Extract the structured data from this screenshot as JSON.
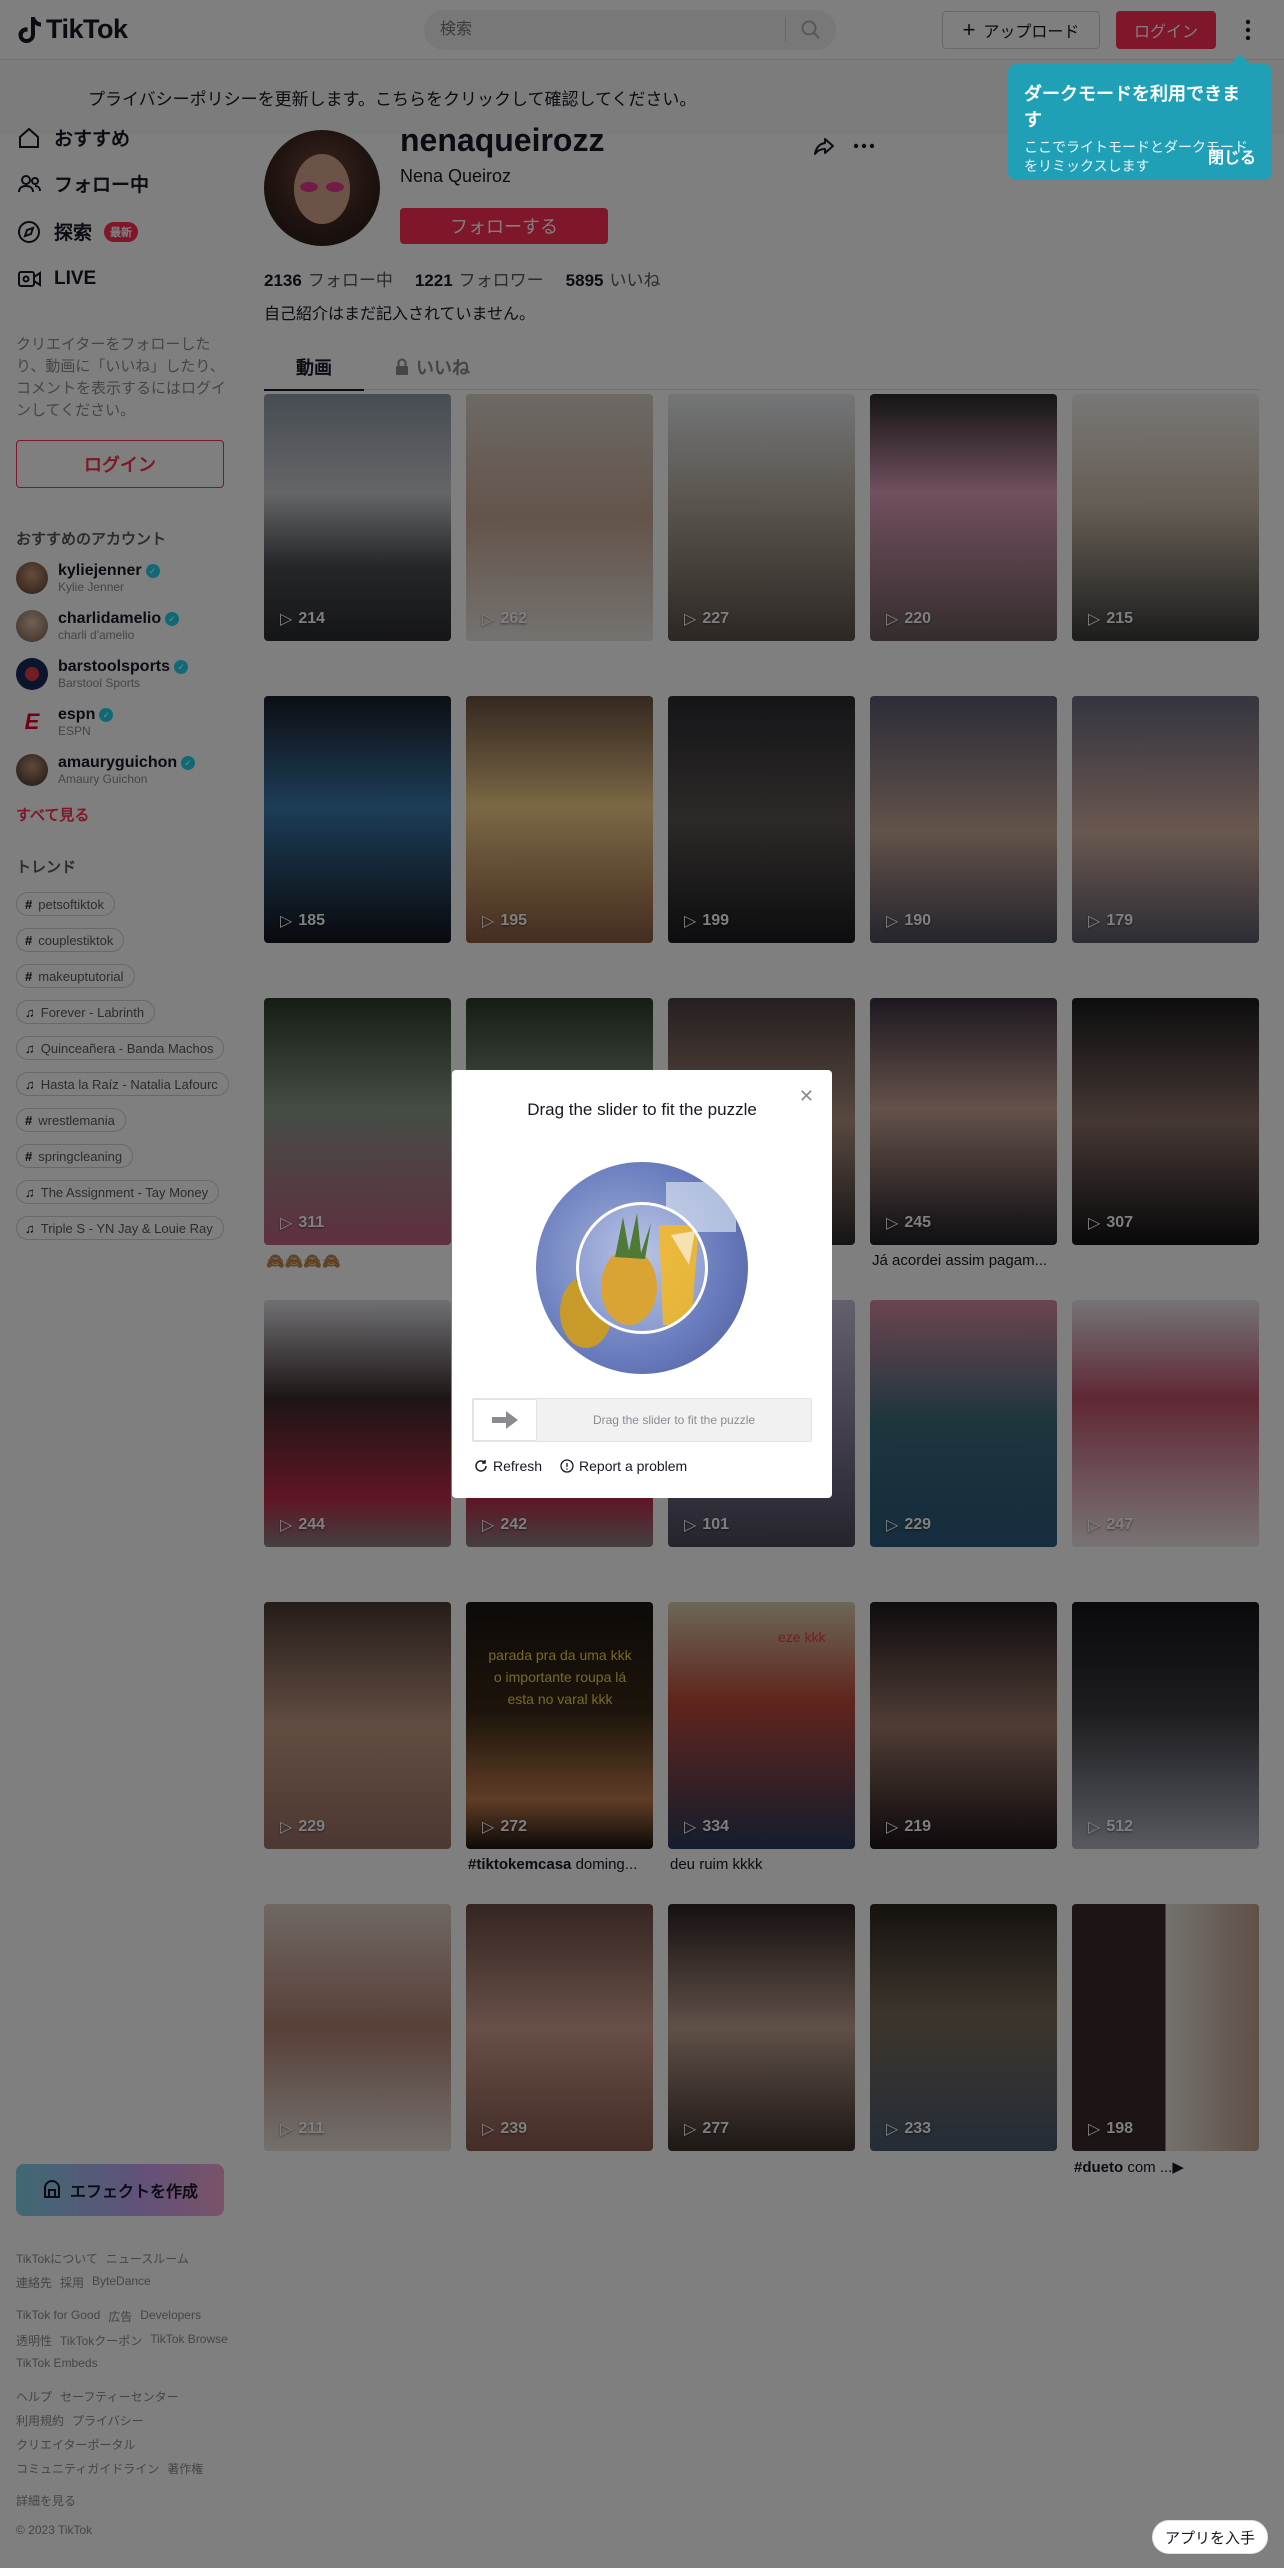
{
  "header": {
    "logo": "TikTok",
    "search_placeholder": "検索",
    "upload_label": "アップロード",
    "login_label": "ログイン"
  },
  "privacy_banner": "プライバシーポリシーを更新します。こちらをクリックして確認してください。",
  "tooltip": {
    "title": "ダークモードを利用できます",
    "desc": "ここでライトモードとダークモードをリミックスします",
    "close": "閉じる"
  },
  "sidebar": {
    "nav": [
      {
        "label": "おすすめ",
        "icon": "home-icon"
      },
      {
        "label": "フォロー中",
        "icon": "following-icon"
      },
      {
        "label": "探索",
        "icon": "explore-icon",
        "badge": "最新"
      },
      {
        "label": "LIVE",
        "icon": "live-icon"
      }
    ],
    "hint": "クリエイターをフォローしたり、動画に「いいね」したり、コメントを表示するにはログインしてください。",
    "login": "ログイン",
    "suggested_title": "おすすめのアカウント",
    "accounts": [
      {
        "name": "kyliejenner",
        "sub": "Kylie Jenner",
        "color": "#5a3a2a"
      },
      {
        "name": "charlidamelio",
        "sub": "charli d'amelio",
        "color": "#a78a72"
      },
      {
        "name": "barstoolsports",
        "sub": "Barstool Sports",
        "color": "#1a2a5a"
      },
      {
        "name": "espn",
        "sub": "ESPN",
        "color": "#e4002b"
      },
      {
        "name": "amauryguichon",
        "sub": "Amaury Guichon",
        "color": "#6a4a3a"
      }
    ],
    "see_all": "すべて見る",
    "trend_title": "トレンド",
    "trends": [
      {
        "label": "petsoftiktok",
        "type": "hashtag"
      },
      {
        "label": "couplestiktok",
        "type": "hashtag"
      },
      {
        "label": "makeuptutorial",
        "type": "hashtag"
      },
      {
        "label": "Forever - Labrinth",
        "type": "music"
      },
      {
        "label": "Quinceañera - Banda Machos",
        "type": "music"
      },
      {
        "label": "Hasta la Raíz - Natalia Lafourc",
        "type": "music"
      },
      {
        "label": "wrestlemania",
        "type": "hashtag"
      },
      {
        "label": "springcleaning",
        "type": "hashtag"
      },
      {
        "label": "The Assignment - Tay Money",
        "type": "music"
      },
      {
        "label": "Triple S - YN Jay & Louie Ray",
        "type": "music"
      }
    ],
    "create_effect": "エフェクトを作成",
    "footer": [
      [
        "TikTokについて",
        "ニュースルーム"
      ],
      [
        "連絡先",
        "採用",
        "ByteDance"
      ],
      [
        "TikTok for Good",
        "広告",
        "Developers"
      ],
      [
        "透明性",
        "TikTokクーポン",
        "TikTok Browse"
      ],
      [
        "TikTok Embeds"
      ],
      [
        "ヘルプ",
        "セーフティーセンター"
      ],
      [
        "利用規約",
        "プライバシー"
      ],
      [
        "クリエイターポータル"
      ],
      [
        "コミュニティガイドライン",
        "著作権"
      ],
      [
        "詳細を見る"
      ]
    ],
    "copyright": "© 2023 TikTok"
  },
  "profile": {
    "username": "nenaqueirozz",
    "nickname": "Nena Queiroz",
    "follow": "フォローする",
    "following_count": "2136",
    "following_label": "フォロー中",
    "followers_count": "1221",
    "followers_label": "フォロワー",
    "likes_count": "5895",
    "likes_label": "いいね",
    "bio": "自己紹介はまだ記入されていません。",
    "tab_videos": "動画",
    "tab_liked": "いいね"
  },
  "videos": [
    {
      "views": "214",
      "bg": "linear-gradient(180deg,#8f9aa6 0%,#c9ccd0 40%,#4a4d52 70%,#2a2b2e 100%)"
    },
    {
      "views": "262",
      "bg": "linear-gradient(180deg,#d9d3cc 0%,#c9a896 50%,#e9e5e0 100%)"
    },
    {
      "views": "227",
      "bg": "linear-gradient(180deg,#e8ecf0 0%,#b3a89a 45%,#5a5048 100%)"
    },
    {
      "views": "220",
      "bg": "linear-gradient(180deg,#2a2a2a 0%,#e3a0bf 40%,#6a5a5a 100%)"
    },
    {
      "views": "215",
      "bg": "linear-gradient(180deg,#f2f0ee 0%,#cbbba8 45%,#3a3a3a 100%)"
    },
    {
      "views": "185",
      "bg": "linear-gradient(180deg,#1a1e28 0%,#3a7ab0 45%,#12141a 100%)"
    },
    {
      "views": "195",
      "bg": "linear-gradient(180deg,#6a5040 0%,#f5d08a 45%,#8a5a40 100%)"
    },
    {
      "views": "199",
      "bg": "linear-gradient(180deg,#2a2a30 0%,#5a5250 50%,#1a1a1e 100%)"
    },
    {
      "views": "190",
      "bg": "linear-gradient(180deg,#5a5a72 0%,#c4a594 55%,#4a4a5a 100%)"
    },
    {
      "views": "179",
      "bg": "linear-gradient(180deg,#6a6a80 0%,#d4b0a0 55%,#5a5a6a 100%)"
    },
    {
      "views": "311",
      "bg": "linear-gradient(180deg,#2a3a2a 0%,#8a9a8a 45%,#c06080 100%)"
    },
    {
      "views": "",
      "bg": "linear-gradient(180deg,#2a3a2a 0%,#8a9a8a 45%,#c06080 100%)"
    },
    {
      "views": "",
      "bg": "linear-gradient(180deg,#4a4040 0%,#b09080 50%,#2a2a2a 100%)"
    },
    {
      "views": "245",
      "bg": "linear-gradient(180deg,#3a3040 0%,#caa494 45%,#1e1e26 100%)"
    },
    {
      "views": "307",
      "bg": "linear-gradient(180deg,#1a1a1e 0%,#8a7068 50%,#121214 100%)"
    },
    {
      "views": "244",
      "bg": "linear-gradient(180deg,#e0e0e8 0%,#3a2a2a 40%,#c02a4a 80%,#8a8080 100%)"
    },
    {
      "views": "242",
      "bg": "linear-gradient(180deg,#e0e0e8 0%,#3a2a2a 40%,#c02a4a 80%,#8a8080 100%)"
    },
    {
      "views": "101",
      "bg": "linear-gradient(180deg,#c8c0d8 0%,#8a80a0 50%,#4a4a5a 100%)"
    },
    {
      "views": "229",
      "bg": "linear-gradient(180deg,#d88aa0 0%,#3a6a7a 50%,#2a5a7a 100%)"
    },
    {
      "views": "247",
      "bg": "linear-gradient(180deg,#e8e8ee 0%,#c0506a 40%,#f0e8e8 100%)"
    },
    {
      "views": "229",
      "bg": "linear-gradient(180deg,#4a3a34 0%,#c49a84 50%,#9a7064 100%)"
    },
    {
      "views": "272",
      "bg": "linear-gradient(180deg,#1a1410 0%,#3a2a18 45%,#c07a4a 80%,#1a1410 100%)"
    },
    {
      "views": "334",
      "bg": "linear-gradient(180deg,#d8d0b0 0%,#c04a3a 40%,#2a3a5a 100%)"
    },
    {
      "views": "219",
      "bg": "linear-gradient(180deg,#1e1a1e 0%,#a07a6a 50%,#1a1418 100%)"
    },
    {
      "views": "512",
      "bg": "linear-gradient(180deg,#141418 0%,#3a3a42 45%,#b0b4c0 100%)"
    },
    {
      "views": "211",
      "bg": "linear-gradient(180deg,#e0d0c8 0%,#b08070 50%,#e8e0dc 100%)"
    },
    {
      "views": "239",
      "bg": "linear-gradient(180deg,#6a4a44 0%,#d0a090 50%,#8a5a50 100%)"
    },
    {
      "views": "277",
      "bg": "linear-gradient(180deg,#2a2220 0%,#c0a090 50%,#3a302c 100%)"
    },
    {
      "views": "233",
      "bg": "linear-gradient(180deg,#2a241e 0%,#7a6a58 45%,#4a5a70 100%)"
    },
    {
      "views": "198",
      "bg": "linear-gradient(90deg,#3a2a2a 0%,#3a2a2a 50%,#e8e4dc 50%,#c0a090 100%)"
    }
  ],
  "captions": [
    {
      "index": 10,
      "bold": "",
      "text": "🙈🙈🙈🙈"
    },
    {
      "index": 13,
      "bold": "",
      "text": "Já acordei assim pagam..."
    },
    {
      "index": 21,
      "bold": "#tiktokemcasa",
      "text": " doming..."
    },
    {
      "index": 22,
      "bold": "",
      "text": "deu ruim kkkk"
    },
    {
      "index": 29,
      "bold": "#dueto",
      "text": " com ...▶"
    }
  ],
  "overlay_text": {
    "tile22": "parada pra da uma kkk o importante roupa lá esta no varal kkk",
    "tile23": "eze kkk"
  },
  "captcha": {
    "title": "Drag the slider to fit the puzzle",
    "slider_hint": "Drag the slider to fit the puzzle",
    "refresh": "Refresh",
    "report": "Report a problem"
  }
}
